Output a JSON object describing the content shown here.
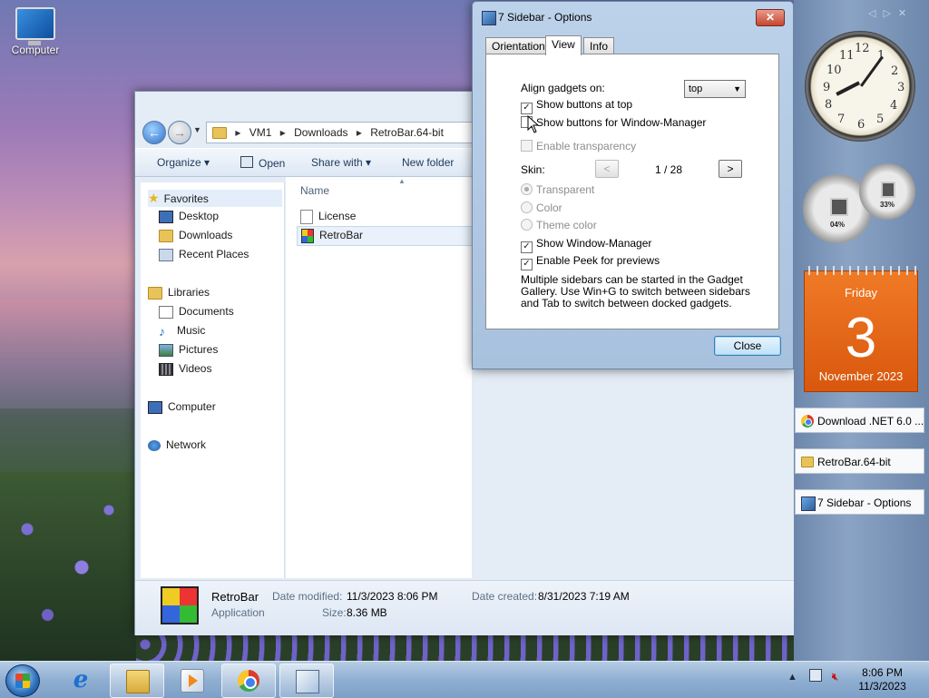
{
  "desktop": {
    "icons": [
      {
        "label": "Computer",
        "icon": "computer-icon"
      }
    ]
  },
  "explorer": {
    "breadcrumb": [
      "VM1",
      "Downloads",
      "RetroBar.64-bit"
    ],
    "commands": {
      "organize": "Organize",
      "open": "Open",
      "share": "Share with",
      "new_folder": "New folder"
    },
    "nav": {
      "favorites": "Favorites",
      "favorites_items": [
        "Desktop",
        "Downloads",
        "Recent Places"
      ],
      "libraries": "Libraries",
      "libraries_items": [
        "Documents",
        "Music",
        "Pictures",
        "Videos"
      ],
      "computer": "Computer",
      "network": "Network"
    },
    "column_name": "Name",
    "files": [
      {
        "name": "License",
        "type": "document"
      },
      {
        "name": "RetroBar",
        "type": "application",
        "selected": true
      }
    ],
    "details": {
      "name": "RetroBar",
      "type": "Application",
      "modified_label": "Date modified:",
      "modified_value": "11/3/2023 8:06 PM",
      "created_label": "Date created:",
      "created_value": "8/31/2023 7:19 AM",
      "size_label": "Size:",
      "size_value": "8.36 MB"
    }
  },
  "dialog": {
    "title": "7 Sidebar - Options",
    "close_glyph": "✕",
    "tabs": [
      "Orientation",
      "View",
      "Info"
    ],
    "active_tab": "View",
    "align_label": "Align gadgets on:",
    "align_value": "top",
    "options": {
      "buttons_top": {
        "label": "Show buttons at top",
        "checked": true
      },
      "buttons_wm": {
        "label": "Show buttons for Window-Manager",
        "checked": false
      },
      "transparency": {
        "label": "Enable transparency",
        "checked": false,
        "disabled": true
      }
    },
    "skin_label": "Skin:",
    "skin_prev": "<",
    "skin_next": ">",
    "skin_page": "1 / 28",
    "radios": {
      "transparent": "Transparent",
      "color": "Color",
      "theme": "Theme color"
    },
    "show_wm": {
      "label": "Show Window-Manager",
      "checked": true
    },
    "peek": {
      "label": "Enable Peek for previews",
      "checked": true
    },
    "note": "Multiple sidebars can be started in the Gadget Gallery. Use Win+G to switch between sidebars and Tab to switch between docked gadgets.",
    "close_button": "Close"
  },
  "sidebar": {
    "clock_numbers": [
      "12",
      "1",
      "2",
      "3",
      "4",
      "5",
      "6",
      "7",
      "8",
      "9",
      "10",
      "11"
    ],
    "clock_time": {
      "hour": 8,
      "minute": 6
    },
    "cpu_percent": "04%",
    "mem_percent": "33%",
    "calendar": {
      "day": "Friday",
      "date": "3",
      "month": "November 2023"
    },
    "windows": [
      {
        "label": "Download .NET 6.0 ...",
        "icon": "chrome-icon"
      },
      {
        "label": "RetroBar.64-bit",
        "icon": "folder-icon"
      },
      {
        "label": "7 Sidebar - Options",
        "icon": "sidebar-app-icon"
      }
    ]
  },
  "taskbar": {
    "time": "8:06 PM",
    "date": "11/3/2023",
    "tray_arrow": "▲"
  }
}
